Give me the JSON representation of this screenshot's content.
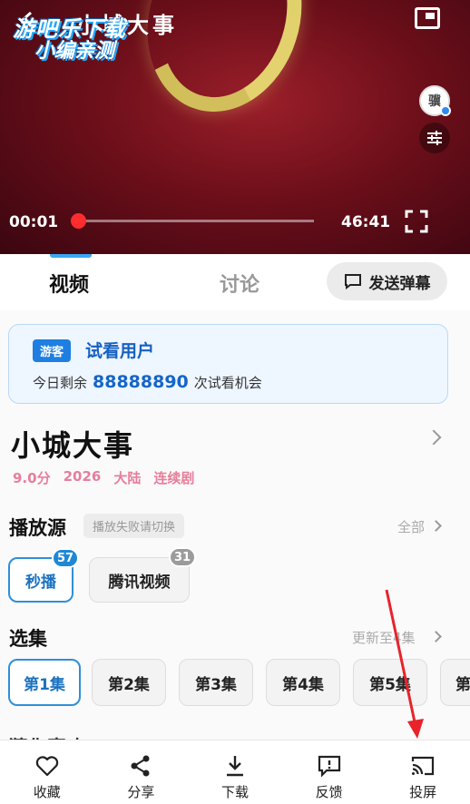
{
  "player": {
    "title": "小城大事",
    "watermark_line1": "游吧乐下载",
    "watermark_line2": "小编亲测",
    "avatar_text": "骥",
    "current_time": "00:01",
    "total_time": "46:41",
    "progress": 0.02
  },
  "tabs": {
    "video": "视频",
    "discuss": "讨论",
    "danmaku_button": "发送弹幕"
  },
  "trial": {
    "tag": "游客",
    "title": "试看用户",
    "prefix": "今日剩余",
    "count": "88888890",
    "suffix": "次试看机会"
  },
  "show": {
    "title": "小城大事",
    "rating": "9.0分",
    "year": "2026",
    "region": "大陆",
    "type": "连续剧"
  },
  "source_section": {
    "title": "播放源",
    "hint": "播放失败请切换",
    "all_link": "全部",
    "sources": [
      {
        "label": "秒播",
        "badge": "57",
        "badge_color": "#1e88d6",
        "active": true
      },
      {
        "label": "腾讯视频",
        "badge": "31",
        "badge_color": "#9b9b9b",
        "active": false
      }
    ]
  },
  "episode_section": {
    "title": "选集",
    "update_link": "更新至4集",
    "episodes": [
      "第1集",
      "第2集",
      "第3集",
      "第4集",
      "第5集",
      "第"
    ]
  },
  "guess_section": {
    "title": "猜你喜欢"
  },
  "bottom_bar": [
    {
      "label": "收藏",
      "icon": "heart-icon"
    },
    {
      "label": "分享",
      "icon": "share-icon"
    },
    {
      "label": "下载",
      "icon": "download-icon"
    },
    {
      "label": "反馈",
      "icon": "feedback-icon"
    },
    {
      "label": "投屏",
      "icon": "cast-icon"
    }
  ],
  "colors": {
    "accent": "#2f8fd8",
    "progress_red": "#ff2d2d",
    "meta_pink": "#e77e9a",
    "annotation_arrow": "#e8232a"
  }
}
